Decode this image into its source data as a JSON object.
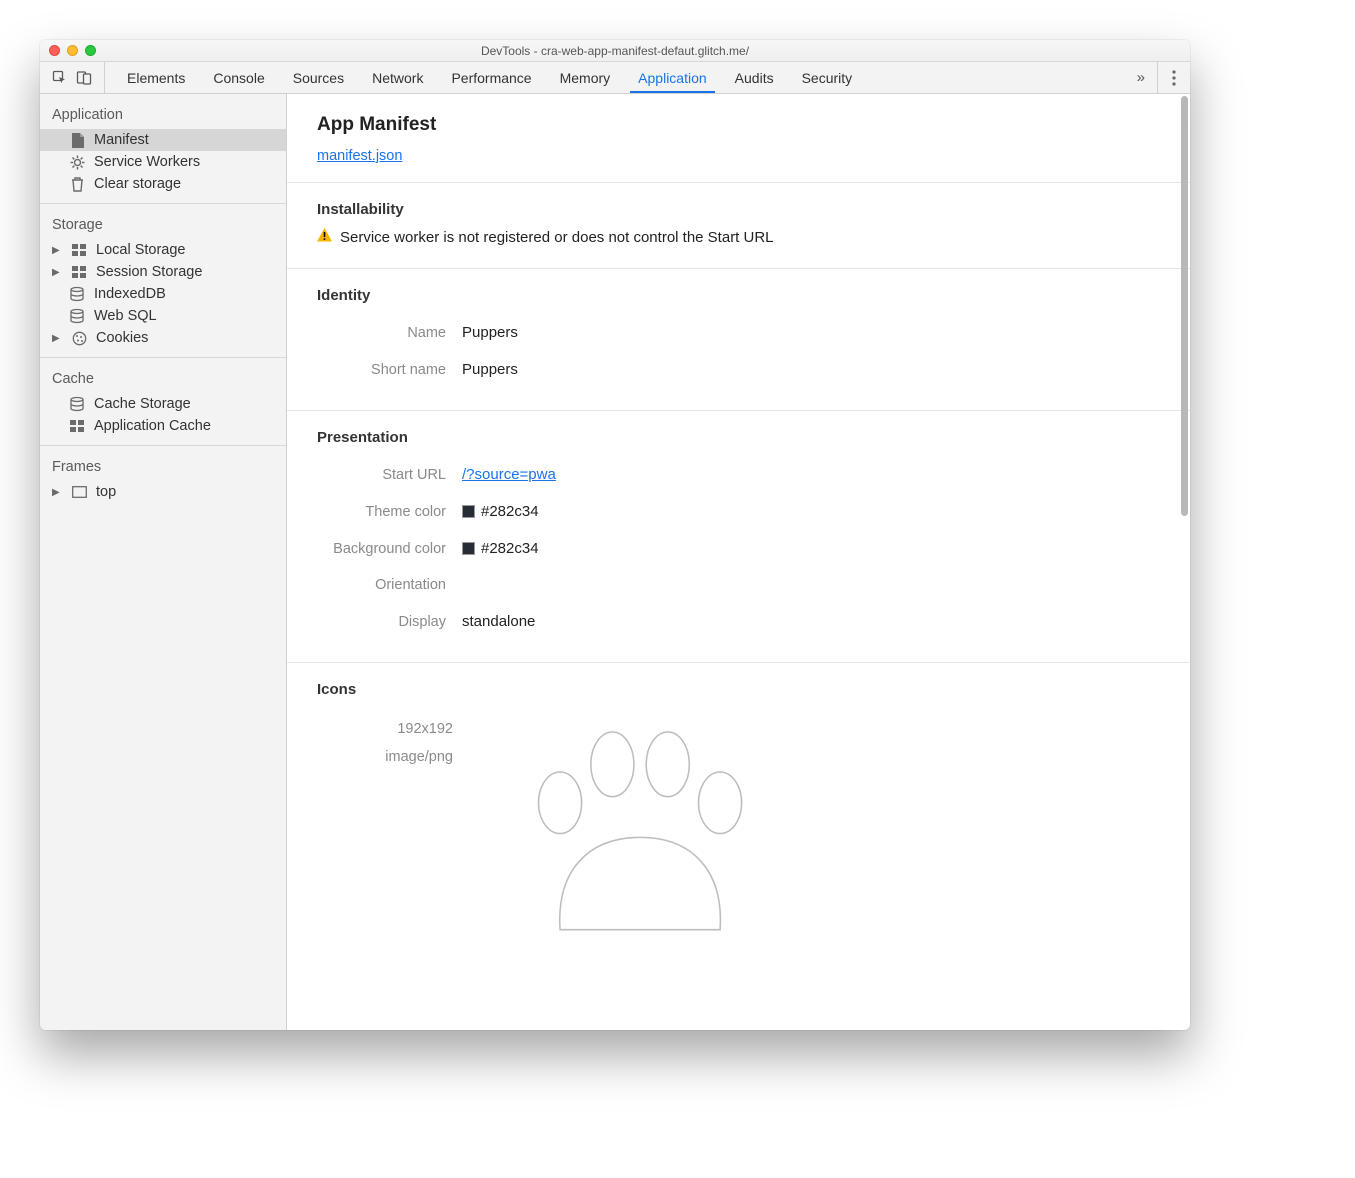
{
  "window": {
    "title": "DevTools - cra-web-app-manifest-defaut.glitch.me/"
  },
  "tabs": {
    "elements": "Elements",
    "console": "Console",
    "sources": "Sources",
    "network": "Network",
    "performance": "Performance",
    "memory": "Memory",
    "application": "Application",
    "audits": "Audits",
    "security": "Security"
  },
  "sidebar": {
    "application": {
      "title": "Application",
      "manifest": "Manifest",
      "service_workers": "Service Workers",
      "clear_storage": "Clear storage"
    },
    "storage": {
      "title": "Storage",
      "local_storage": "Local Storage",
      "session_storage": "Session Storage",
      "indexeddb": "IndexedDB",
      "web_sql": "Web SQL",
      "cookies": "Cookies"
    },
    "cache": {
      "title": "Cache",
      "cache_storage": "Cache Storage",
      "application_cache": "Application Cache"
    },
    "frames": {
      "title": "Frames",
      "top": "top"
    }
  },
  "main": {
    "title": "App Manifest",
    "manifest_link": "manifest.json",
    "installability": {
      "title": "Installability",
      "warning": "Service worker is not registered or does not control the Start URL"
    },
    "identity": {
      "title": "Identity",
      "name_label": "Name",
      "name_value": "Puppers",
      "short_name_label": "Short name",
      "short_name_value": "Puppers"
    },
    "presentation": {
      "title": "Presentation",
      "start_url_label": "Start URL",
      "start_url_value": "/?source=pwa",
      "theme_color_label": "Theme color",
      "theme_color_value": "#282c34",
      "background_color_label": "Background color",
      "background_color_value": "#282c34",
      "orientation_label": "Orientation",
      "orientation_value": "",
      "display_label": "Display",
      "display_value": "standalone"
    },
    "icons": {
      "title": "Icons",
      "size": "192x192",
      "mime": "image/png"
    }
  },
  "colors": {
    "accent": "#1a73e8",
    "swatch": "#282c34"
  }
}
